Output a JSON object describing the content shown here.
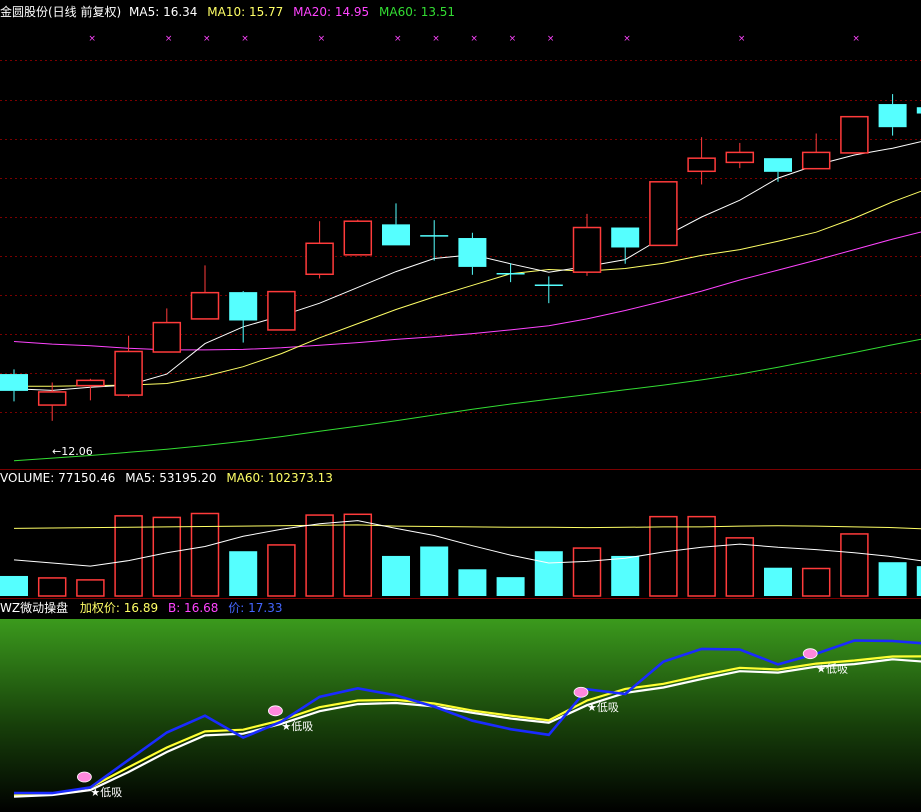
{
  "main_header": {
    "title": "金圆股份(日线 前复权)",
    "ma5": "MA5: 16.34",
    "ma10": "MA10: 15.77",
    "ma20": "MA20: 14.95",
    "ma60": "MA60: 13.51"
  },
  "low_label": "←12.06",
  "volume_header": {
    "volume": "VOLUME: 77150.46",
    "ma5": "MA5: 53195.20",
    "ma60": "MA60: 102373.13"
  },
  "indicator_header": {
    "name": "WZ微动操盘",
    "weighted": "加权价: 16.89",
    "b": "B: 16.68",
    "price": "价: 17.33"
  },
  "signal_label": "★低吸",
  "colors": {
    "up": "#ff3b3b",
    "down": "#55ffff",
    "ma5": "#ffffff",
    "ma10": "#ffff66",
    "ma20": "#ff44ff",
    "ma60": "#33dd33",
    "grid": "#7a0000"
  },
  "chart_data": [
    {
      "type": "candlestick",
      "title": "金圆股份(日线 前复权)",
      "candles": [
        {
          "open": 12.95,
          "close": 12.63,
          "high": 13.04,
          "low": 12.43
        },
        {
          "open": 12.36,
          "close": 12.61,
          "high": 12.79,
          "low": 12.06
        },
        {
          "open": 12.73,
          "close": 12.83,
          "high": 12.86,
          "low": 12.45
        },
        {
          "open": 12.55,
          "close": 13.38,
          "high": 13.68,
          "low": 12.51
        },
        {
          "open": 13.37,
          "close": 13.93,
          "high": 14.2,
          "low": 13.37
        },
        {
          "open": 14.0,
          "close": 14.5,
          "high": 15.02,
          "low": 14.0
        },
        {
          "open": 14.51,
          "close": 13.97,
          "high": 14.53,
          "low": 13.55
        },
        {
          "open": 13.79,
          "close": 14.52,
          "high": 14.52,
          "low": 13.79
        },
        {
          "open": 14.85,
          "close": 15.44,
          "high": 15.86,
          "low": 14.77
        },
        {
          "open": 15.22,
          "close": 15.86,
          "high": 15.89,
          "low": 15.22
        },
        {
          "open": 15.8,
          "close": 15.4,
          "high": 16.2,
          "low": 15.4
        },
        {
          "open": 15.58,
          "close": 15.58,
          "high": 15.88,
          "low": 15.11
        },
        {
          "open": 15.54,
          "close": 14.99,
          "high": 15.64,
          "low": 14.84
        },
        {
          "open": 14.86,
          "close": 14.86,
          "high": 15.06,
          "low": 14.7
        },
        {
          "open": 14.64,
          "close": 14.64,
          "high": 14.81,
          "low": 14.3
        },
        {
          "open": 14.89,
          "close": 15.74,
          "high": 16.0,
          "low": 14.82
        },
        {
          "open": 15.74,
          "close": 15.36,
          "high": 15.74,
          "low": 15.05
        },
        {
          "open": 15.4,
          "close": 16.61,
          "high": 16.61,
          "low": 15.4
        },
        {
          "open": 16.81,
          "close": 17.06,
          "high": 17.46,
          "low": 16.56
        },
        {
          "open": 16.98,
          "close": 17.17,
          "high": 17.35,
          "low": 16.87
        },
        {
          "open": 17.06,
          "close": 16.8,
          "high": 17.06,
          "low": 16.61
        },
        {
          "open": 16.86,
          "close": 17.17,
          "high": 17.53,
          "low": 16.86
        },
        {
          "open": 17.16,
          "close": 17.85,
          "high": 17.85,
          "low": 17.16
        },
        {
          "open": 18.09,
          "close": 17.65,
          "high": 18.28,
          "low": 17.49
        },
        {
          "open": 18.03,
          "close": 17.91,
          "high": 18.08,
          "low": 17.91
        }
      ],
      "ma5": [
        12.67,
        12.64,
        12.7,
        12.74,
        12.95,
        13.53,
        13.85,
        14.06,
        14.3,
        14.6,
        14.9,
        15.15,
        15.22,
        15.05,
        14.89,
        15.0,
        15.13,
        15.56,
        15.94,
        16.26,
        16.68,
        16.93,
        17.12,
        17.25,
        17.42
      ],
      "ma10": [
        12.72,
        12.72,
        12.73,
        12.74,
        12.77,
        12.91,
        13.09,
        13.34,
        13.64,
        13.91,
        14.18,
        14.42,
        14.64,
        14.86,
        14.94,
        14.91,
        14.96,
        15.06,
        15.21,
        15.32,
        15.48,
        15.65,
        15.92,
        16.23,
        16.5
      ],
      "ma20": [
        13.57,
        13.52,
        13.49,
        13.44,
        13.41,
        13.41,
        13.42,
        13.45,
        13.5,
        13.55,
        13.61,
        13.66,
        13.72,
        13.79,
        13.87,
        14.0,
        14.16,
        14.34,
        14.53,
        14.74,
        14.93,
        15.12,
        15.32,
        15.52,
        15.7
      ],
      "ma60": [
        11.3,
        11.35,
        11.4,
        11.46,
        11.52,
        11.59,
        11.67,
        11.76,
        11.86,
        11.96,
        12.06,
        12.17,
        12.28,
        12.38,
        12.47,
        12.56,
        12.65,
        12.74,
        12.84,
        12.95,
        13.08,
        13.22,
        13.36,
        13.51,
        13.65
      ],
      "ylim": [
        11.2,
        19.5
      ],
      "annotations": [
        "←12.06"
      ],
      "grid": true
    },
    {
      "type": "bar",
      "title": "VOLUME",
      "values": [
        25500,
        23000,
        20500,
        102000,
        100000,
        105000,
        57000,
        65000,
        103000,
        104000,
        51000,
        63000,
        34000,
        24000,
        57000,
        61000,
        51000,
        101000,
        101000,
        74000,
        36000,
        35000,
        79000,
        43000,
        38000
      ],
      "directions": [
        "down",
        "up",
        "up",
        "up",
        "up",
        "up",
        "down",
        "up",
        "up",
        "up",
        "down",
        "down",
        "down",
        "down",
        "down",
        "up",
        "down",
        "up",
        "up",
        "up",
        "down",
        "up",
        "up",
        "down",
        "down"
      ],
      "ma5": [
        46000,
        42000,
        38000,
        45000,
        55000,
        63000,
        76000,
        85000,
        92000,
        96000,
        86000,
        77000,
        64000,
        52000,
        42000,
        44000,
        48000,
        56000,
        62000,
        66000,
        62000,
        59000,
        55000,
        50000,
        43000
      ],
      "ma60": [
        86000,
        86500,
        87000,
        87500,
        88000,
        88500,
        89000,
        89500,
        90000,
        90500,
        89000,
        88500,
        88000,
        87500,
        87500,
        87000,
        87500,
        88000,
        88000,
        89000,
        89500,
        89000,
        88000,
        87000,
        85000
      ],
      "ylim": [
        0,
        140000
      ]
    },
    {
      "type": "line",
      "title": "WZ微动操盘",
      "series": [
        {
          "name": "加权价",
          "values": [
            11.95,
            12.0,
            12.23,
            12.95,
            13.65,
            14.22,
            14.28,
            14.62,
            15.08,
            15.32,
            15.34,
            15.21,
            14.96,
            14.78,
            14.61,
            15.32,
            15.73,
            15.91,
            16.21,
            16.48,
            16.42,
            16.63,
            16.74,
            16.88,
            16.89
          ]
        },
        {
          "name": "B",
          "values": [
            11.9,
            11.96,
            12.14,
            12.78,
            13.49,
            14.08,
            14.14,
            14.49,
            14.94,
            15.19,
            15.23,
            15.11,
            14.88,
            14.68,
            14.53,
            15.15,
            15.59,
            15.78,
            16.08,
            16.36,
            16.31,
            16.52,
            16.61,
            16.78,
            16.68
          ]
        },
        {
          "name": "价",
          "values": [
            12.03,
            12.03,
            12.23,
            13.21,
            14.18,
            14.78,
            14.0,
            14.57,
            15.45,
            15.75,
            15.5,
            15.1,
            14.6,
            14.3,
            14.1,
            15.72,
            15.55,
            16.7,
            17.15,
            17.13,
            16.6,
            16.98,
            17.45,
            17.43,
            17.33
          ]
        }
      ],
      "signals": [
        {
          "index": 2,
          "label": "★低吸"
        },
        {
          "index": 7,
          "label": "★低吸"
        },
        {
          "index": 15,
          "label": "★低吸"
        },
        {
          "index": 21,
          "label": "★低吸"
        }
      ],
      "ylim": [
        11.5,
        18.0
      ]
    }
  ]
}
